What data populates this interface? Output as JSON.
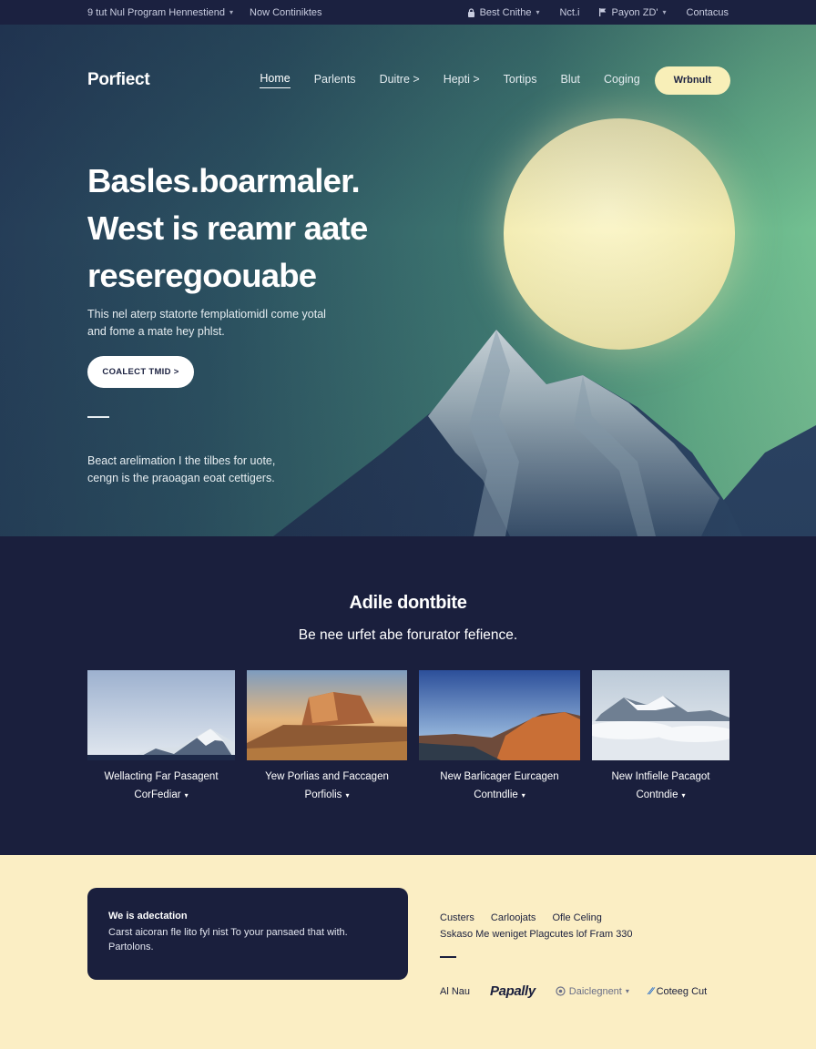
{
  "topbar": {
    "left": [
      {
        "label": "9 tut Nul Program Hennestiend",
        "has_dropdown": true
      },
      {
        "label": "Now Continiktes",
        "has_dropdown": false
      }
    ],
    "right": [
      {
        "icon": "lock-icon",
        "label": "Best Cnithe",
        "has_dropdown": true
      },
      {
        "icon": "",
        "label": "Nct.i",
        "has_dropdown": false
      },
      {
        "icon": "flag-icon",
        "label": "Payon ZD'",
        "has_dropdown": true
      },
      {
        "icon": "",
        "label": "Contacus",
        "has_dropdown": false
      }
    ]
  },
  "nav": {
    "logo": "Porfiect",
    "links": [
      {
        "label": "Home",
        "active": true
      },
      {
        "label": "Parlents",
        "active": false
      },
      {
        "label": "Duitre >",
        "active": false
      },
      {
        "label": "Hepti >",
        "active": false
      },
      {
        "label": "Tortips",
        "active": false
      },
      {
        "label": "Blut",
        "active": false
      },
      {
        "label": "Coging",
        "active": false
      }
    ],
    "cta": "Wrbnult"
  },
  "hero": {
    "title_lines": [
      "Basles.boarmaler.",
      "West is reamr aate",
      "reseregoouabe"
    ],
    "subtitle_lines": [
      "This nel aterp statorte femplatiomidl come yotal",
      "and fome a mate hey phlst."
    ],
    "button": "COALECT TMID >",
    "note_lines": [
      "Beact arelimation I the tilbes for uote,",
      "cengn is the praoagan eoat cettigers."
    ]
  },
  "portfolio": {
    "title": "Adile dontbite",
    "subtitle": "Be nee urfet abe forurator fefience.",
    "cards": [
      {
        "line1": "Wellacting Far Pasagent",
        "line2": "CorFediar"
      },
      {
        "line1": "Yew Porlias and Faccagen",
        "line2": "Porfiolis"
      },
      {
        "line1": "New Barlicager Eurcagen",
        "line2": "Contndlie"
      },
      {
        "line1": "New Intfielle Pacagot",
        "line2": "Contndie"
      }
    ]
  },
  "bottom": {
    "box_title": "We is adectation",
    "box_lines": [
      "Carst aicoran fle lito fyl nist To your pansaed that with.",
      "Partolons."
    ],
    "links": [
      "Custers",
      "Carloojats",
      "Ofle Celing"
    ],
    "line": "Sskaso Me weniget Plagcutes lof Fram 330",
    "logos": [
      "Al Nau",
      "Papally",
      "Daiclegnent",
      "Coteeg Cut"
    ]
  },
  "colors": {
    "navy": "#1a1f3d",
    "cream": "#fbeec4",
    "sun": "#f3ecb2",
    "accent_green": "#7cc896",
    "logo_blue": "#1c67c9"
  }
}
